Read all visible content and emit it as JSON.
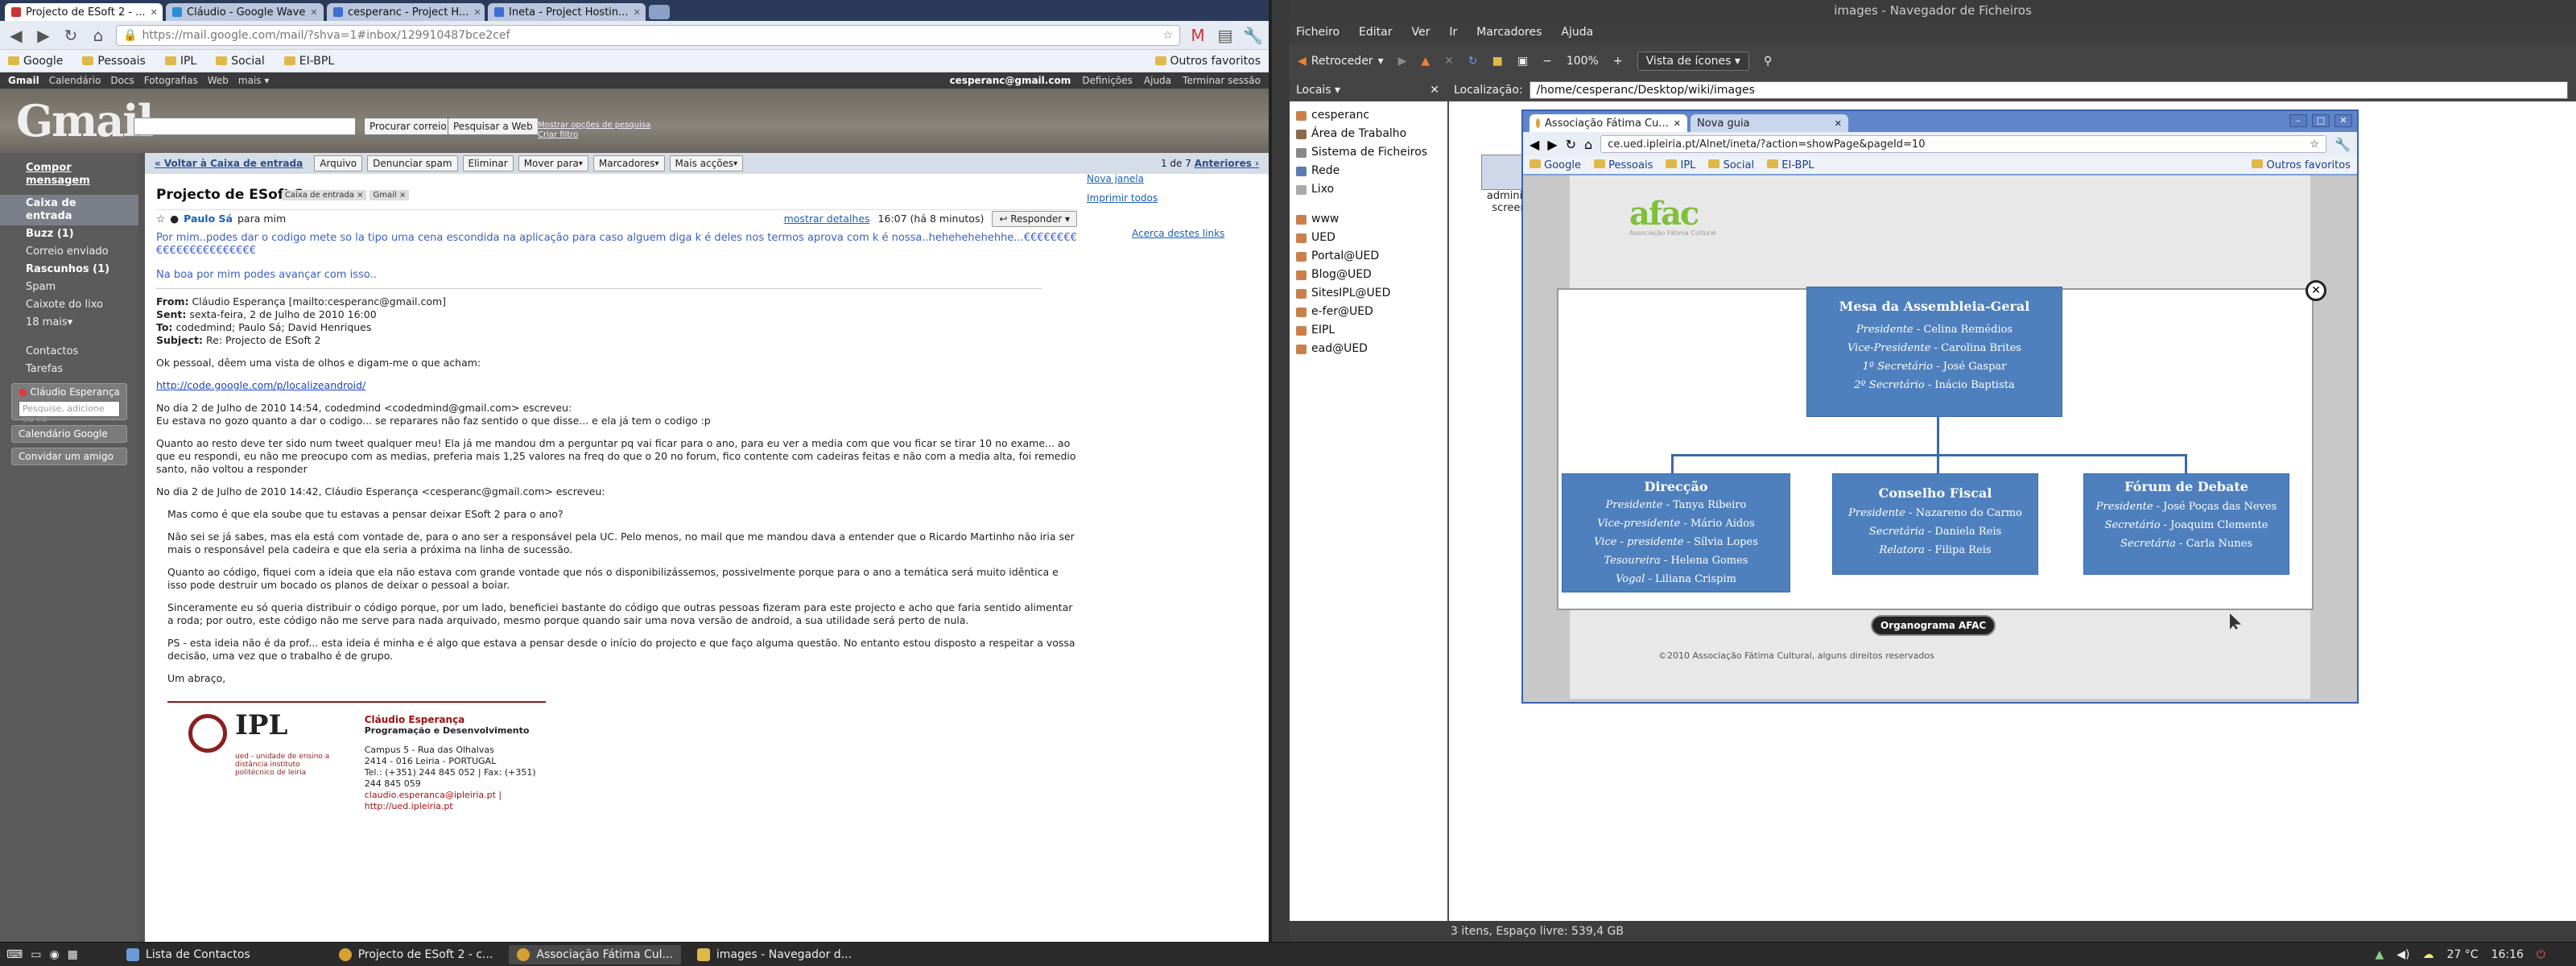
{
  "left_browser": {
    "tabs": [
      {
        "label": "Projecto de ESoft 2 - ...",
        "active": true
      },
      {
        "label": "Cláudio - Google Wave",
        "active": false
      },
      {
        "label": "cesperanc - Project H...",
        "active": false
      },
      {
        "label": "Ineta - Project Hostin...",
        "active": false
      }
    ],
    "url": "https://mail.google.com/mail/?shva=1#inbox/129910487bce2cef",
    "bookmarks": [
      "Google",
      "Pessoais",
      "IPL",
      "Social",
      "EI-BPL"
    ],
    "bookmarks_other": "Outros favoritos"
  },
  "gmail": {
    "topbar_links": [
      "Gmail",
      "Calendário",
      "Docs",
      "Fotografias",
      "Web",
      "mais ▾"
    ],
    "account": "cesperanc@gmail.com",
    "account_links": [
      "Definições",
      "Ajuda",
      "Terminar sessão"
    ],
    "search_mail_btn": "Procurar correio",
    "search_web_btn": "Pesquisar a Web",
    "search_options": [
      "Mostrar opções de pesquisa",
      "Criar filtro"
    ],
    "sidebar": {
      "compose": "Compor mensagem",
      "items": [
        "Caixa de entrada",
        "Buzz (1)",
        "Correio enviado",
        "Rascunhos (1)",
        "Spam",
        "Caixote do lixo",
        "18 mais▾"
      ],
      "extra": [
        "Contactos",
        "Tarefas"
      ],
      "chat_user": "Cláudio Esperança",
      "chat_search": "Pesquise, adicione ou co",
      "calendar": "Calendário Google",
      "invite": "Convidar um amigo"
    },
    "actions": {
      "back": "« Voltar à Caixa de entrada",
      "buttons": [
        "Arquivo",
        "Denunciar spam",
        "Eliminar"
      ],
      "dropdowns": [
        "Mover para",
        "Marcadores",
        "Mais acções"
      ],
      "pager": "1 de 7",
      "pager_link": "Anteriores ›"
    },
    "subject": "Projecto de ESoft 2",
    "labels": [
      "Caixa de entrada",
      "Gmail"
    ],
    "message": {
      "sender": "Paulo Sá",
      "to": "para mim",
      "show_details": "mostrar detalhes",
      "time": "16:07 (há 8 minutos)",
      "reply": "Responder",
      "intro1": "Por mim..podes dar o codigo mete so la tipo uma cena escondida na aplicação para caso alguem diga k é deles nos termos aprova com k é nossa..hehehehehehhe...€€€€€€€€€€€€€€€€€€€€€€€",
      "intro2": "Na boa por mim podes avançar com isso..",
      "from_label": "From:",
      "from": "Cláudio Esperança [mailto:cesperanc@gmail.com]",
      "sent_label": "Sent:",
      "sent": "sexta-feira, 2 de Julho de 2010 16:00",
      "to_label": "To:",
      "to_list": "codedmind; Paulo Sá; David Henriques",
      "subject_label": "Subject:",
      "subject_line": "Re: Projecto de ESoft 2",
      "p1": "Ok pessoal, dêem uma vista de olhos e digam-me o que acham:",
      "link": "http://code.google.com/p/localizeandroid/",
      "p2a": "No dia 2 de Julho de 2010 14:54, codedmind <codedmind@gmail.com> escreveu:",
      "p2b": "Eu estava no gozo quanto a dar o codigo... se reparares não faz sentido o que disse... e ela já tem o codigo :p",
      "p3": "Quanto ao resto deve ter sido num tweet qualquer meu! Ela já me mandou dm a perguntar pq vai ficar para o ano, para eu ver a media com que vou ficar se tirar 10 no exame... ao que eu respondi, eu não me preocupo com as medias, preferia mais 1,25 valores na freq do que o 20 no forum, fico contente com cadeiras feitas e não com a media alta, foi remedio santo, não voltou a responder",
      "p4": "No dia 2 de Julho de 2010 14:42, Cláudio Esperança <cesperanc@gmail.com> escreveu:",
      "q1": "Mas como é que ela soube que tu estavas a pensar deixar ESoft 2 para o ano?",
      "q2": "Não sei se já sabes, mas ela está com vontade de, para o ano ser a responsável pela UC. Pelo menos, no mail que me mandou dava a entender que o Ricardo Martinho não iria ser mais o responsável pela cadeira e que ela seria a próxima na linha de sucessão.",
      "q3": "Quanto ao código, fiquei com a ideia que ela não estava com grande vontade que nós o disponibilizássemos, possivelmente porque para o ano a temática será muito idêntica e isso pode destruir um bocado os planos de deixar o pessoal a boiar.",
      "q4": "Sinceramente eu só queria distribuir o código porque, por um lado, beneficiei bastante do código que outras pessoas fizeram para este projecto e acho que faria sentido alimentar a roda; por outro, este código não me serve para nada arquivado, mesmo porque quando sair uma nova versão de android, a sua utilidade será perto de nula.",
      "q5": "PS - esta ideia não é da prof... esta ideia é minha e é algo que estava a pensar desde o início do projecto e que faço alguma questão. No entanto estou disposto a respeitar a vossa decisão, uma vez que o trabalho é de grupo.",
      "q6": "Um abraço,"
    },
    "side_links": [
      "Nova janela",
      "Imprimir todos"
    ],
    "about_links": "Acerca destes links",
    "signature": {
      "logo_text": "IPL",
      "logo_sub": "ued - unidade de ensino a distância\ninstituto politécnico de leiria",
      "name": "Cláudio Esperança",
      "dept": "Programação e Desenvolvimento",
      "addr1": "Campus 5 - Rua das Olhalvas",
      "addr2": "2414 - 016 Leiria - PORTUGAL",
      "tel": "Tel.: (+351) 244 845 052 | Fax: (+351) 244 845 059",
      "links": "claudio.esperanca@ipleiria.pt | http://ued.ipleiria.pt"
    }
  },
  "file_manager": {
    "title": "images - Navegador de Ficheiros",
    "menu": [
      "Ficheiro",
      "Editar",
      "Ver",
      "Ir",
      "Marcadores",
      "Ajuda"
    ],
    "back": "Retroceder",
    "zoom": "100%",
    "view": "Vista de ícones",
    "places": "Locais ▾",
    "location_label": "Localização:",
    "path": "/home/cesperanc/Desktop/wiki/images",
    "sidebar1": [
      "cesperanc",
      "Área de Trabalho",
      "Sistema de Ficheiros",
      "Rede",
      "Lixo"
    ],
    "sidebar2": [
      "www",
      "UED",
      "Portal@UED",
      "Blog@UED",
      "SitesIPL@UED",
      "e-fer@UED",
      "EIPL",
      "ead@UED"
    ],
    "file_label": "administ screen",
    "status": "3 itens, Espaço livre: 539,4 GB"
  },
  "afac_browser": {
    "tabs": [
      "Associação Fátima Cu...",
      "Nova guia"
    ],
    "url": "ce.ued.ipleiria.pt/Alnet/ineta/?action=showPage&pageId=10",
    "bookmarks": [
      "Google",
      "Pessoais",
      "IPL",
      "Social",
      "EI-BPL"
    ],
    "other": "Outros favoritos",
    "logo": "afac",
    "logo_sub": "Associação Fátima Cultural",
    "footer": "©2010 Associação Fátima Cultural, alguns direitos reservados",
    "orgbtn": "Organograma AFAC",
    "boxes": {
      "mesa": {
        "title": "Mesa da Assembleia-Geral",
        "rows": [
          [
            "Presidente",
            "Celina Remédios"
          ],
          [
            "Vice-Presidente",
            "Carolina Brites"
          ],
          [
            "1º Secretário",
            "José Gaspar"
          ],
          [
            "2º Secretário",
            "Inácio Baptista"
          ]
        ]
      },
      "direccao": {
        "title": "Direcção",
        "rows": [
          [
            "Presidente",
            "Tanya Ribeiro"
          ],
          [
            "Vice-presidente",
            "Mário Aidos"
          ],
          [
            "Vice - presidente",
            "Sílvia Lopes"
          ],
          [
            "Tesoureira",
            "Helena Gomes"
          ],
          [
            "Vogal",
            "Liliana Crispim"
          ]
        ]
      },
      "conselho": {
        "title": "Conselho Fiscal",
        "rows": [
          [
            "Presidente",
            "Nazareno do Carmo"
          ],
          [
            "Secretária",
            "Daniela Reis"
          ],
          [
            "Relatora",
            "Filipa Reis"
          ]
        ]
      },
      "forum": {
        "title": "Fórum de Debate",
        "rows": [
          [
            "Presidente",
            "José Poças das Neves"
          ],
          [
            "Secretário",
            "Joaquim Clemente"
          ],
          [
            "Secretária",
            "Carla Nunes"
          ]
        ]
      }
    }
  },
  "taskbar": {
    "items": [
      {
        "label": "Lista de Contactos",
        "active": false
      },
      {
        "label": "Projecto de ESoft 2 - c...",
        "active": false
      },
      {
        "label": "Associação Fátima Cul...",
        "active": true
      },
      {
        "label": "images - Navegador d...",
        "active": false
      }
    ],
    "temp": "27 °C",
    "clock": "16:16"
  }
}
